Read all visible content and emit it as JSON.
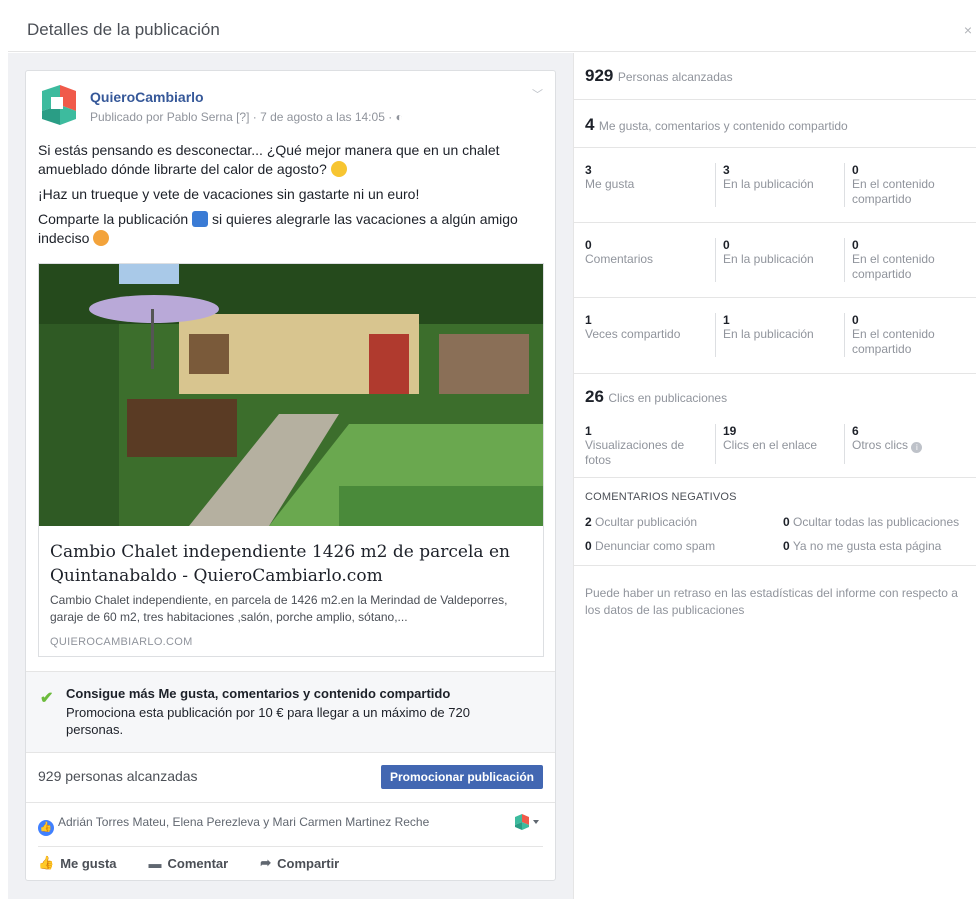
{
  "dialog": {
    "title": "Detalles de la publicación",
    "close": "×"
  },
  "post": {
    "page_name": "QuieroCambiarlo",
    "byline": "Publicado por Pablo Serna [?] · 7 de agosto a las 14:05 · ◐",
    "paragraph1": "Si estás pensando es desconectar... ¿Qué mejor manera que en un chalet amueblado dónde librarte del calor de agosto?",
    "paragraph2": "¡Haz un trueque y vete de vacaciones sin gastarte ni un euro!",
    "paragraph3a": "Comparte la publicación",
    "paragraph3b": "si quieres alegrarle las vacaciones a algún amigo indeciso",
    "link_title": "Cambio Chalet independiente 1426 m2 de parcela en Quintanabaldo - QuieroCambiarlo.com",
    "link_desc": "Cambio Chalet independiente, en parcela de 1426 m2.en la Merindad de Valdeporres, garaje de 60 m2, tres habitaciones ,salón, porche amplio, sótano,...",
    "link_domain": "QUIEROCAMBIARLO.COM",
    "promo_head": "Consigue más Me gusta, comentarios y contenido compartido",
    "promo_body": "Promociona esta publicación por 10 € para llegar a un máximo de 720 personas.",
    "reach": "929 personas alcanzadas",
    "promote_btn": "Promocionar publicación",
    "likers": "Adrián Torres Mateu, Elena Perezleva y Mari Carmen Martinez Reche",
    "actions": {
      "like": "Me gusta",
      "comment": "Comentar",
      "share": "Compartir"
    }
  },
  "stats": {
    "reach_num": "929",
    "reach_lbl": "Personas alcanzadas",
    "eng_num": "4",
    "eng_lbl": "Me gusta, comentarios y contenido compartido",
    "likes": {
      "total": "3",
      "total_lbl": "Me gusta",
      "post": "3",
      "post_lbl": "En la publicación",
      "shared": "0",
      "shared_lbl": "En el contenido compartido"
    },
    "comments": {
      "total": "0",
      "total_lbl": "Comentarios",
      "post": "0",
      "post_lbl": "En la publicación",
      "shared": "0",
      "shared_lbl": "En el contenido compartido"
    },
    "shares": {
      "total": "1",
      "total_lbl": "Veces compartido",
      "post": "1",
      "post_lbl": "En la publicación",
      "shared": "0",
      "shared_lbl": "En el contenido compartido"
    },
    "clicks_num": "26",
    "clicks_lbl": "Clics en publicaciones",
    "clicks": {
      "photo": "1",
      "photo_lbl": "Visualizaciones de fotos",
      "link": "19",
      "link_lbl": "Clics en el enlace",
      "other": "6",
      "other_lbl": "Otros clics"
    },
    "neg_title": "COMENTARIOS NEGATIVOS",
    "neg": {
      "hide_post_n": "2",
      "hide_post": "Ocultar publicación",
      "hide_all_n": "0",
      "hide_all": "Ocultar todas las publicaciones",
      "spam_n": "0",
      "spam": "Denunciar como spam",
      "unlike_n": "0",
      "unlike": "Ya no me gusta esta página"
    },
    "note": "Puede haber un retraso en las estadísticas del informe con respecto a los datos de las publicaciones"
  }
}
